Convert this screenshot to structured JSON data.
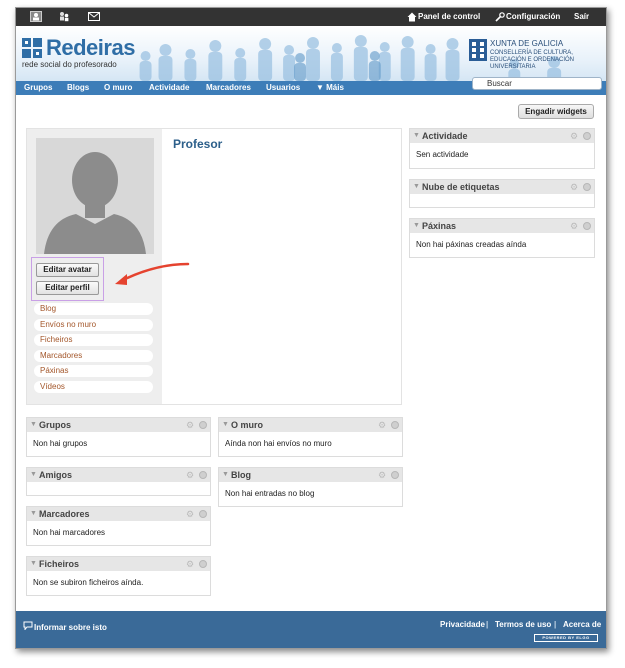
{
  "topbar": {
    "icons": [
      "profile-icon",
      "friends-icon",
      "mail-icon"
    ],
    "control_panel": "Panel de control",
    "settings": "Configuración",
    "logout": "Saír"
  },
  "banner": {
    "site_name": "Redeiras",
    "tagline": "rede social do profesorado",
    "xunta_name": "XUNTA DE GALICIA",
    "xunta_dept": "CONSELLERÍA DE CULTURA, EDUCACIÓN E ORDENACIÓN UNIVERSITARIA"
  },
  "nav": {
    "items": [
      "Grupos",
      "Blogs",
      "O muro",
      "Actividade",
      "Marcadores",
      "Usuarios"
    ],
    "more": "▼ Máis",
    "search_placeholder": "Buscar"
  },
  "add_widgets": "Engadir widgets",
  "profile": {
    "title": "Profesor",
    "edit_avatar": "Editar avatar",
    "edit_profile": "Editar perfil",
    "menu": [
      "Blog",
      "Envíos no muro",
      "Ficheiros",
      "Marcadores",
      "Páxinas",
      "Vídeos"
    ]
  },
  "widgets_left": [
    {
      "title": "Grupos",
      "body": "Non hai grupos"
    },
    {
      "title": "Amigos",
      "body": ""
    },
    {
      "title": "Marcadores",
      "body": "Non hai marcadores"
    },
    {
      "title": "Ficheiros",
      "body": "Non se subiron ficheiros aínda."
    }
  ],
  "widgets_middle": [
    {
      "title": "O muro",
      "body": "Aínda non hai envíos no muro"
    },
    {
      "title": "Blog",
      "body": "Non hai entradas no blog"
    }
  ],
  "widgets_right": [
    {
      "title": "Actividade",
      "body": "Sen actividade"
    },
    {
      "title": "Nube de etiquetas",
      "body": ""
    },
    {
      "title": "Páxinas",
      "body": "Non hai páxinas creadas aínda"
    }
  ],
  "footer": {
    "report": "Informar sobre isto",
    "privacy": "Privacidade",
    "terms": "Termos de uso",
    "about": "Acerca de",
    "powered": "POWERED BY ELGG"
  },
  "colors": {
    "nav_bg": "#3d7db8",
    "footer_bg": "#3a6a98",
    "link": "#a3562a",
    "title": "#2c5f8a"
  }
}
